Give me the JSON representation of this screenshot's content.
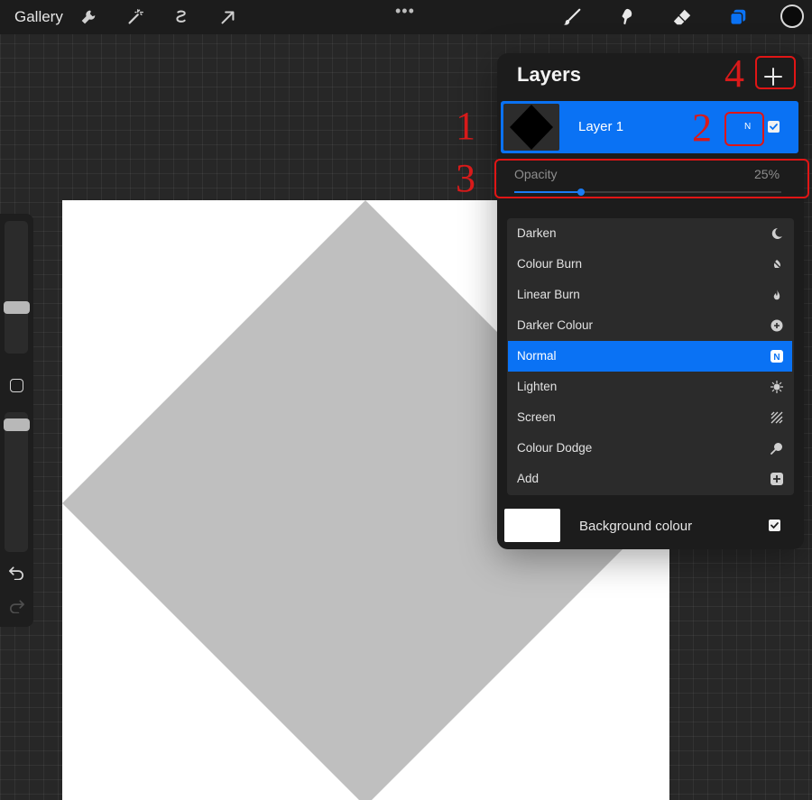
{
  "toolbar": {
    "gallery_label": "Gallery",
    "tools": [
      "wrench-icon",
      "magic-wand-icon",
      "selection-icon",
      "transform-arrow-icon"
    ],
    "more_label": "•••",
    "right_tools": [
      "brush-icon",
      "smudge-icon",
      "eraser-icon",
      "layers-icon"
    ],
    "current_color": "#0a0a0a"
  },
  "layers_panel": {
    "title": "Layers",
    "add_button_icon": "plus-icon",
    "layer": {
      "name": "Layer 1",
      "blend_mode_short": "N",
      "visible": true
    },
    "opacity": {
      "label": "Opacity",
      "value_text": "25%",
      "value": 0.25
    },
    "blend_modes": [
      {
        "label": "Darken",
        "icon": "moon-icon",
        "active": false
      },
      {
        "label": "Colour Burn",
        "icon": "burn-icon",
        "active": false
      },
      {
        "label": "Linear Burn",
        "icon": "flame-icon",
        "active": false
      },
      {
        "label": "Darker Colour",
        "icon": "plus-circle-icon",
        "active": false
      },
      {
        "label": "Normal",
        "icon": "n-badge-icon",
        "icon_text": "N",
        "active": true
      },
      {
        "label": "Lighten",
        "icon": "burst-icon",
        "active": false
      },
      {
        "label": "Screen",
        "icon": "hatch-icon",
        "active": false
      },
      {
        "label": "Colour Dodge",
        "icon": "dodge-icon",
        "active": false
      },
      {
        "label": "Add",
        "icon": "plus-square-icon",
        "active": false
      }
    ],
    "background": {
      "label": "Background colour",
      "color": "#ffffff",
      "visible": true
    }
  },
  "annotations": [
    "1",
    "2",
    "3",
    "4"
  ],
  "colors": {
    "accent": "#0a72f4",
    "callout": "#e01515",
    "shape_gray": "#bfbfbf"
  }
}
